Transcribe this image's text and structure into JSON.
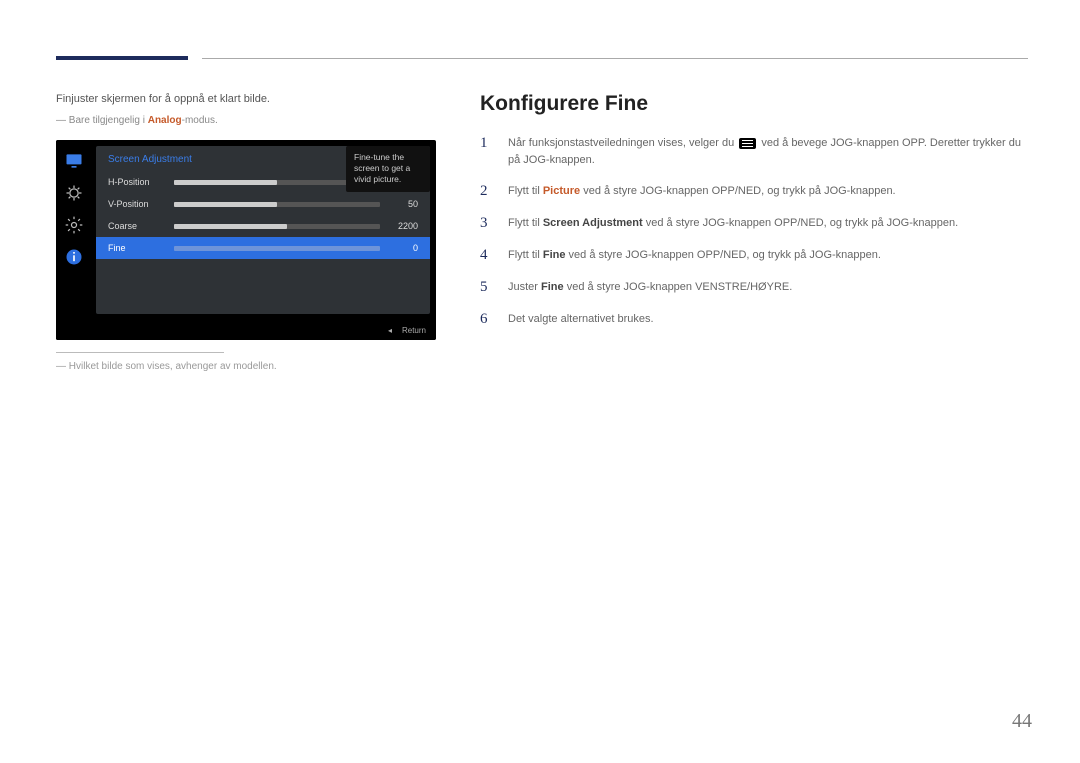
{
  "left": {
    "intro": "Finjuster skjermen for å oppnå et klart bilde.",
    "note_prefix": "― Bare tilgjengelig i ",
    "note_em": "Analog",
    "note_suffix": "-modus.",
    "osd": {
      "title": "Screen Adjustment",
      "rows": [
        {
          "label": "H-Position",
          "value": "50",
          "pct": 50,
          "selected": false
        },
        {
          "label": "V-Position",
          "value": "50",
          "pct": 50,
          "selected": false
        },
        {
          "label": "Coarse",
          "value": "2200",
          "pct": 55,
          "selected": false
        },
        {
          "label": "Fine",
          "value": "0",
          "pct": 0,
          "selected": true
        }
      ],
      "tooltip": "Fine-tune the screen to get a vivid picture.",
      "return": "Return"
    },
    "modelnote": "― Hvilket bilde som vises, avhenger av modellen."
  },
  "right": {
    "heading": "Konfigurere Fine",
    "steps": [
      {
        "n": "1",
        "parts": [
          {
            "t": "text",
            "v": "Når funksjonstastveiledningen vises, velger du "
          },
          {
            "t": "glyph"
          },
          {
            "t": "text",
            "v": " ved å bevege JOG-knappen OPP. Deretter trykker du på JOG-knappen."
          }
        ]
      },
      {
        "n": "2",
        "parts": [
          {
            "t": "text",
            "v": "Flytt til "
          },
          {
            "t": "em",
            "v": "Picture"
          },
          {
            "t": "text",
            "v": " ved å styre JOG-knappen OPP/NED, og trykk på JOG-knappen."
          }
        ]
      },
      {
        "n": "3",
        "parts": [
          {
            "t": "text",
            "v": "Flytt til "
          },
          {
            "t": "bold",
            "v": "Screen Adjustment"
          },
          {
            "t": "text",
            "v": " ved å styre JOG-knappen OPP/NED, og trykk på JOG-knappen."
          }
        ]
      },
      {
        "n": "4",
        "parts": [
          {
            "t": "text",
            "v": "Flytt til "
          },
          {
            "t": "bold",
            "v": "Fine"
          },
          {
            "t": "text",
            "v": " ved å styre JOG-knappen OPP/NED, og trykk på JOG-knappen."
          }
        ]
      },
      {
        "n": "5",
        "parts": [
          {
            "t": "text",
            "v": "Juster "
          },
          {
            "t": "bold",
            "v": "Fine"
          },
          {
            "t": "text",
            "v": " ved å styre JOG-knappen VENSTRE/HØYRE."
          }
        ]
      },
      {
        "n": "6",
        "parts": [
          {
            "t": "text",
            "v": "Det valgte alternativet brukes."
          }
        ]
      }
    ]
  },
  "page_number": "44"
}
